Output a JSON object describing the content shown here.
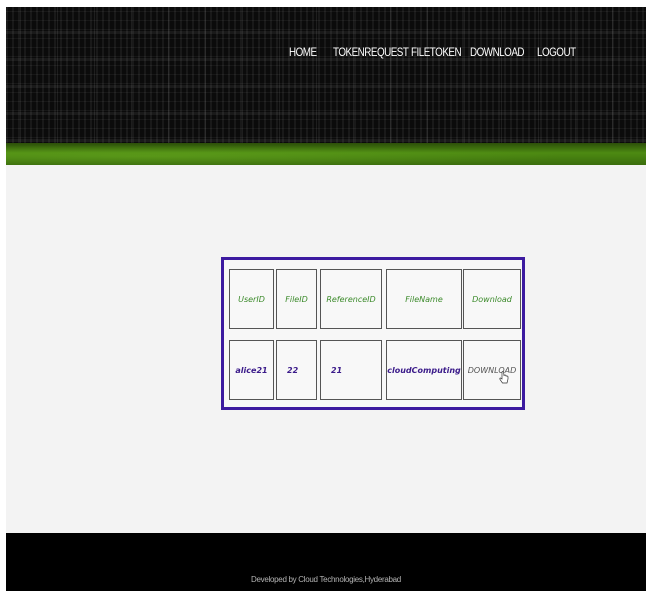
{
  "nav": {
    "items": [
      {
        "label": "HOME"
      },
      {
        "label": "TOKENREQUEST"
      },
      {
        "label": "FILETOKEN"
      },
      {
        "label": "DOWNLOAD"
      },
      {
        "label": "LOGOUT"
      }
    ]
  },
  "table": {
    "headers": [
      "UserID",
      "FileID",
      "ReferenceID",
      "FileName",
      "Download"
    ],
    "rows": [
      {
        "user_id": "alice21",
        "file_id": "22",
        "reference_id": "21",
        "file_name": "cloudComputing",
        "download": "DOWNLOAD"
      }
    ]
  },
  "footer": {
    "text": "Developed by Cloud Technologies,Hyderabad"
  },
  "colors": {
    "header_bg": "#0b0b0b",
    "green_band": "#4d8a12",
    "table_border": "#3c1aa0",
    "header_text": "#3b8a2a",
    "body_text": "#3b1b8a",
    "footer_bg": "#000000"
  }
}
